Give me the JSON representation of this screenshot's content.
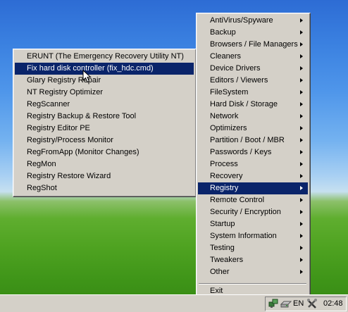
{
  "registry_submenu": {
    "items": [
      {
        "label": "ERUNT (The Emergency Recovery Utility NT)",
        "selected": false
      },
      {
        "label": "Fix hard disk controller (fix_hdc.cmd)",
        "selected": true
      },
      {
        "label": "Glary Registry Repair",
        "selected": false
      },
      {
        "label": "NT Registry Optimizer",
        "selected": false
      },
      {
        "label": "RegScanner",
        "selected": false
      },
      {
        "label": "Registry Backup & Restore Tool",
        "selected": false
      },
      {
        "label": "Registry Editor PE",
        "selected": false
      },
      {
        "label": "Registry/Process Monitor",
        "selected": false
      },
      {
        "label": "RegFromApp (Monitor Changes)",
        "selected": false
      },
      {
        "label": "RegMon",
        "selected": false
      },
      {
        "label": "Registry Restore Wizard",
        "selected": false
      },
      {
        "label": "RegShot",
        "selected": false
      }
    ]
  },
  "main_menu": {
    "items": [
      {
        "label": "AntiVirus/Spyware",
        "submenu": true
      },
      {
        "label": "Backup",
        "submenu": true
      },
      {
        "label": "Browsers / File Managers",
        "submenu": true
      },
      {
        "label": "Cleaners",
        "submenu": true
      },
      {
        "label": "Device Drivers",
        "submenu": true
      },
      {
        "label": "Editors / Viewers",
        "submenu": true
      },
      {
        "label": "FileSystem",
        "submenu": true
      },
      {
        "label": "Hard Disk / Storage",
        "submenu": true
      },
      {
        "label": "Network",
        "submenu": true
      },
      {
        "label": "Optimizers",
        "submenu": true
      },
      {
        "label": "Partition / Boot / MBR",
        "submenu": true
      },
      {
        "label": "Passwords / Keys",
        "submenu": true
      },
      {
        "label": "Process",
        "submenu": true
      },
      {
        "label": "Recovery",
        "submenu": true
      },
      {
        "label": "Registry",
        "submenu": true,
        "selected": true
      },
      {
        "label": "Remote Control",
        "submenu": true
      },
      {
        "label": "Security / Encryption",
        "submenu": true
      },
      {
        "label": "Startup",
        "submenu": true
      },
      {
        "label": "System Information",
        "submenu": true
      },
      {
        "label": "Testing",
        "submenu": true
      },
      {
        "label": "Tweakers",
        "submenu": true
      },
      {
        "label": "Other",
        "submenu": true
      }
    ],
    "exit_label": "Exit"
  },
  "taskbar": {
    "language": "EN",
    "clock": "02:48",
    "tray_icons": [
      "network-icon",
      "drive-icon",
      "tools-icon"
    ]
  },
  "colors": {
    "menu_bg": "#d4d0c8",
    "highlight": "#0a246a",
    "highlight_text": "#ffffff"
  }
}
